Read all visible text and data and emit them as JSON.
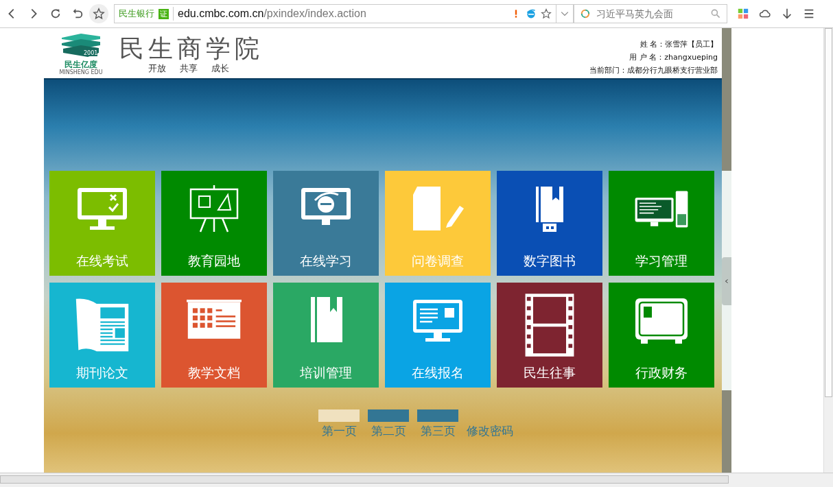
{
  "browser": {
    "site_badge": "民生银行",
    "cert_badge": "证",
    "url_host": "edu.cmbc.com.cn",
    "url_path": "/pxindex/index.action",
    "search": {
      "placeholder": "习近平马英九会面"
    }
  },
  "header": {
    "logo_text": "民生亿度",
    "logo_subtext": "MINSHENG EDU",
    "logo_year": "2001",
    "title": "民生商学院",
    "slogans": [
      "开放",
      "共享",
      "成长"
    ],
    "user_info": [
      {
        "label": "姓 名：",
        "value": "张雪萍【员工】"
      },
      {
        "label": "用 户 名：",
        "value": "zhangxueping"
      },
      {
        "label": "当前部门：",
        "value": "成都分行九眼桥支行营业部"
      }
    ]
  },
  "tiles": [
    {
      "label": "在线考试",
      "color": "#7cbd00",
      "kind": "exam"
    },
    {
      "label": "教育园地",
      "color": "#008a00",
      "kind": "easel"
    },
    {
      "label": "在线学习",
      "color": "#3a7a98",
      "kind": "browser"
    },
    {
      "label": "问卷调查",
      "color": "#fdc93a",
      "kind": "document"
    },
    {
      "label": "数字图书",
      "color": "#0a4fb4",
      "kind": "ebook"
    },
    {
      "label": "学习管理",
      "color": "#008a00",
      "kind": "computer"
    },
    {
      "label": "期刊论文",
      "color": "#16b6d0",
      "kind": "newspaper"
    },
    {
      "label": "教学文档",
      "color": "#dc5530",
      "kind": "slides"
    },
    {
      "label": "培训管理",
      "color": "#2aa864",
      "kind": "book"
    },
    {
      "label": "在线报名",
      "color": "#0aa4e4",
      "kind": "register"
    },
    {
      "label": "民生往事",
      "color": "#7e2430",
      "kind": "film"
    },
    {
      "label": "行政财务",
      "color": "#008a00",
      "kind": "safe"
    }
  ],
  "pager": {
    "pages": [
      {
        "label": "第一页",
        "selected": true
      },
      {
        "label": "第二页",
        "selected": false
      },
      {
        "label": "第三页",
        "selected": false
      }
    ],
    "change_password": "修改密码"
  }
}
